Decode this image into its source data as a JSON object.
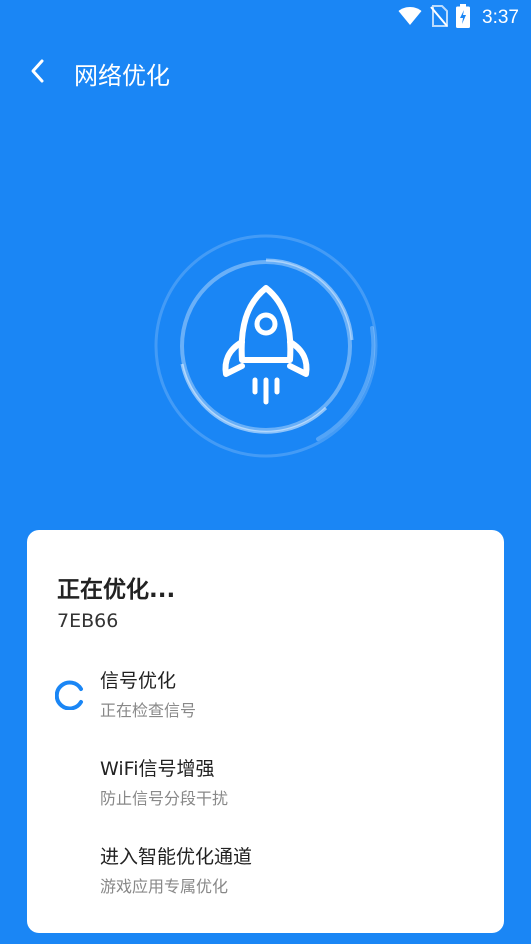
{
  "status_bar": {
    "time": "3:37",
    "icons": [
      "wifi-icon",
      "no-sim-icon",
      "battery-charging-icon"
    ]
  },
  "header": {
    "back_icon": "chevron-left-icon",
    "title": "网络优化"
  },
  "hero": {
    "icon": "rocket-icon"
  },
  "card": {
    "title": "正在优化...",
    "code": "7EB66",
    "tasks": [
      {
        "name": "信号优化",
        "desc": "正在检查信号",
        "state": "loading"
      },
      {
        "name": "WiFi信号增强",
        "desc": "防止信号分段干扰",
        "state": "pending"
      },
      {
        "name": "进入智能优化通道",
        "desc": "游戏应用专属优化",
        "state": "pending"
      }
    ]
  },
  "colors": {
    "background": "#1a86f5",
    "card": "#ffffff",
    "accent": "#1a86f5"
  }
}
